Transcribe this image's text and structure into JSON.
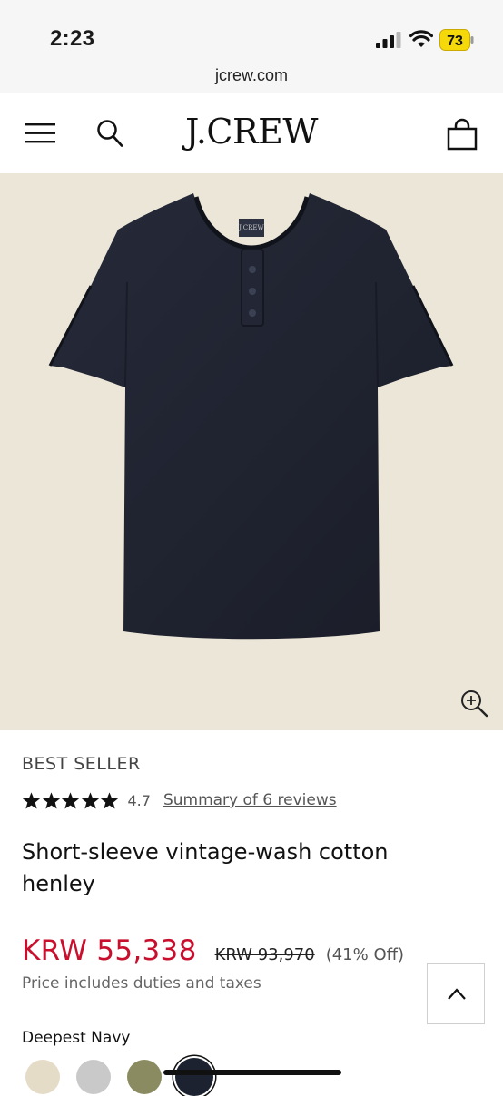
{
  "status_bar": {
    "time": "2:23",
    "battery": "73",
    "icons": [
      "signal-icon",
      "wifi-icon",
      "battery-icon"
    ]
  },
  "browser": {
    "url": "jcrew.com"
  },
  "header": {
    "logo": "J.CREW",
    "icons": [
      "menu-icon",
      "search-icon",
      "bag-icon"
    ]
  },
  "product": {
    "image_alt": "navy henley t-shirt",
    "badge": "BEST SELLER",
    "rating": "4.7",
    "stars": 5,
    "reviews_link": "Summary of 6 reviews",
    "title": "Short-sleeve vintage-wash cotton henley",
    "sale_price": "KRW 55,338",
    "original_price": "KRW 93,970",
    "discount": "(41% Off)",
    "duties_note": "Price includes duties and taxes",
    "color_label": "Deepest Navy",
    "swatches": [
      "#e5dcc8",
      "#c9c9c9",
      "#8b8b62",
      "#1c2230"
    ],
    "selected_swatch": 3
  },
  "colors": {
    "sale": "#c8102e",
    "hero_bg": "#ece6d9",
    "shirt": "#1f2331"
  }
}
